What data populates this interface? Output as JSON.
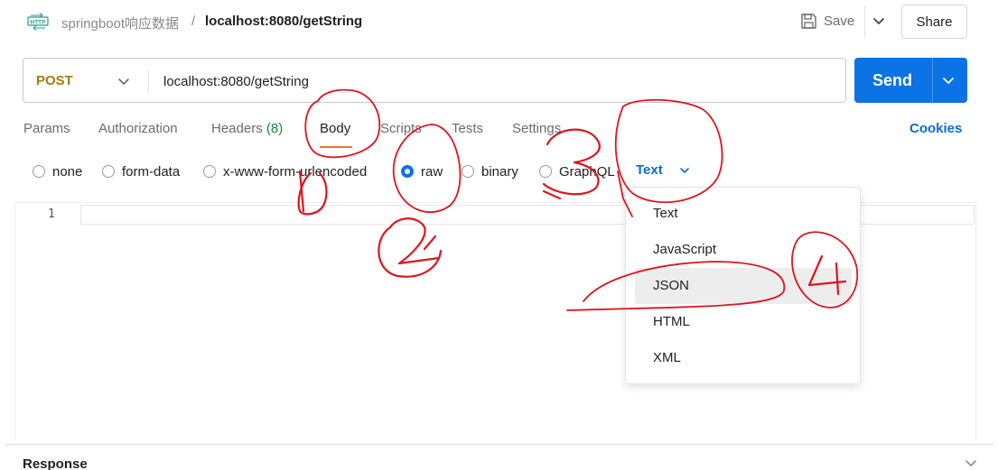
{
  "header": {
    "collection": "springboot响应数据",
    "separator": "/",
    "request_name": "localhost:8080/getString",
    "save_label": "Save",
    "share_label": "Share"
  },
  "request": {
    "method": "POST",
    "url": "localhost:8080/getString",
    "send_label": "Send"
  },
  "tabs": [
    {
      "label": "Params"
    },
    {
      "label": "Authorization"
    },
    {
      "label": "Headers",
      "count": "(8)"
    },
    {
      "label": "Body",
      "active": true
    },
    {
      "label": "Scripts"
    },
    {
      "label": "Tests"
    },
    {
      "label": "Settings"
    }
  ],
  "cookies_label": "Cookies",
  "body_types": [
    {
      "label": "none"
    },
    {
      "label": "form-data"
    },
    {
      "label": "x-www-form-urlencoded"
    },
    {
      "label": "raw",
      "selected": true
    },
    {
      "label": "binary"
    },
    {
      "label": "GraphQL"
    }
  ],
  "format_selected": "Text",
  "format_menu": [
    "Text",
    "JavaScript",
    "JSON",
    "HTML",
    "XML"
  ],
  "format_hovered": "JSON",
  "editor": {
    "line_numbers": [
      "1"
    ]
  },
  "response_label": "Response",
  "annotations": [
    "1",
    "2",
    "3",
    "4"
  ],
  "colors": {
    "accent": "#0b73e6",
    "method_post": "#a57a10",
    "tab_active_underline": "#ff6c37",
    "annotation": "#e0141e",
    "headers_count": "#0f8a3a"
  }
}
